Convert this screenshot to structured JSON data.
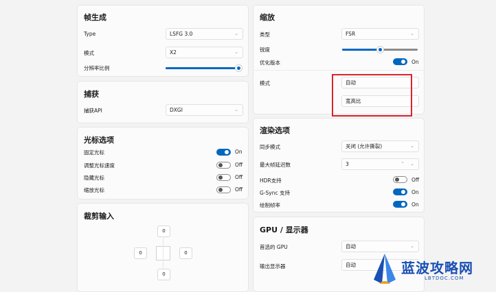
{
  "frame_gen": {
    "title": "帧生成",
    "type_label": "Type",
    "type_value": "LSFG 3.0",
    "mode_label": "模式",
    "mode_value": "X2",
    "resolution_label": "分辨率比例",
    "resolution_level": 1.0
  },
  "capture": {
    "title": "捕获",
    "api_label": "捕获API",
    "api_value": "DXGI"
  },
  "cursor": {
    "title": "光标选项",
    "items": [
      {
        "label": "固定光标",
        "state": "On",
        "on": true
      },
      {
        "label": "调整光标速度",
        "state": "Off",
        "on": false
      },
      {
        "label": "隐藏光标",
        "state": "Off",
        "on": false
      },
      {
        "label": "缩放光标",
        "state": "Off",
        "on": false
      }
    ]
  },
  "crop": {
    "title": "裁剪输入",
    "top": "0",
    "left": "0",
    "right": "0",
    "bottom": "0"
  },
  "scaling": {
    "title": "缩放",
    "type_label": "类型",
    "type_value": "FSR",
    "sharpness_label": "锐度",
    "sharpness_level": 0.5,
    "optimized_label": "优化版本",
    "optimized_state": "On",
    "mode_label": "模式",
    "mode_value": "自动",
    "aspect_value": "宽高比"
  },
  "render": {
    "title": "渲染选项",
    "sync_label": "同步模式",
    "sync_value": "关闭 (允许撕裂)",
    "latency_label": "最大帧延迟数",
    "latency_value": "3",
    "hdr_label": "HDR支持",
    "hdr_state": "Off",
    "gsync_label": "G-Sync 支持",
    "gsync_state": "On",
    "draw_label": "绘制帧率",
    "draw_state": "On"
  },
  "gpu": {
    "title": "GPU / 显示器",
    "gpu_label": "首选的 GPU",
    "gpu_value": "自动",
    "display_label": "输出显示器",
    "display_value": "自动"
  },
  "watermark": {
    "name": "蓝波攻略网",
    "url": "LBTDOC.COM"
  },
  "colors": {
    "accent": "#0067c0",
    "highlight": "#d9232d"
  }
}
